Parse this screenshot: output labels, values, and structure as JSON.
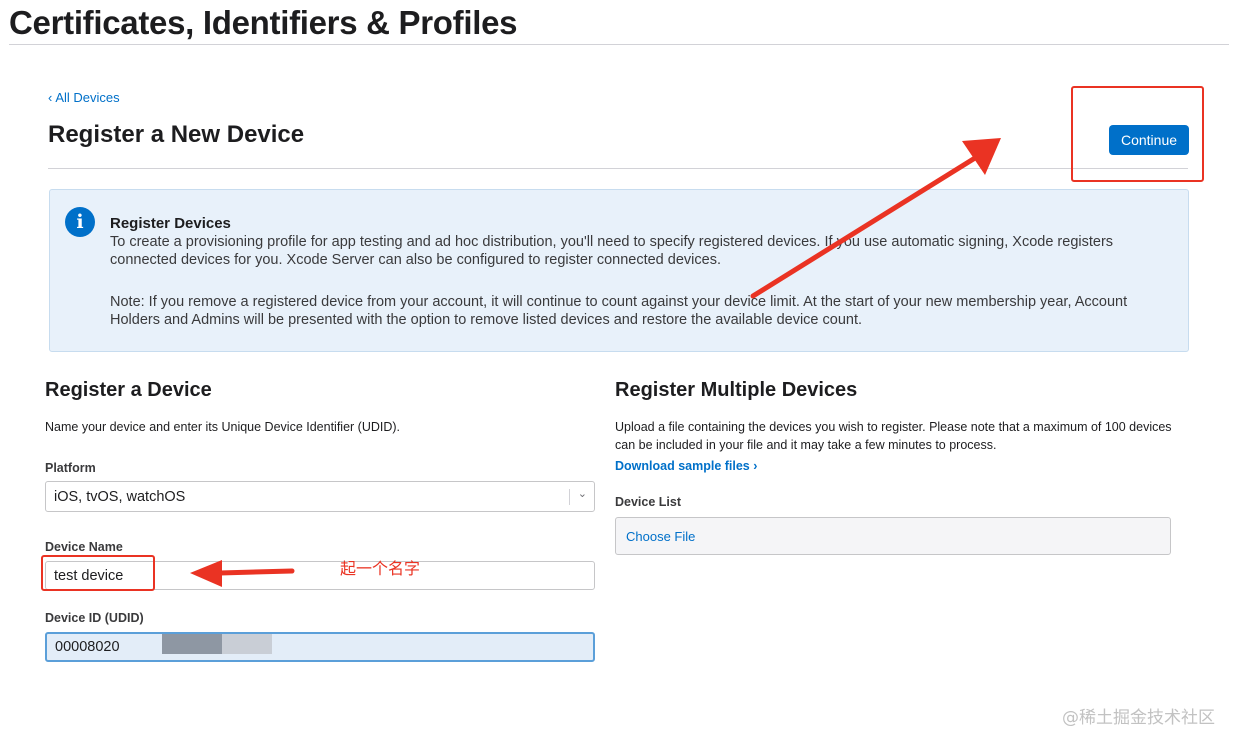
{
  "header": {
    "title": "Certificates, Identifiers & Profiles"
  },
  "nav": {
    "back_label": "All Devices",
    "back_chevron": "‹"
  },
  "page": {
    "title": "Register a New Device",
    "continue_label": "Continue"
  },
  "info": {
    "icon": "info-icon",
    "heading": "Register Devices",
    "paragraph1": "To create a provisioning profile for app testing and ad hoc distribution, you'll need to specify registered devices. If you use automatic signing, Xcode registers connected devices for you. Xcode Server can also be configured to register connected devices.",
    "paragraph2": "Note: If you remove a registered device from your account, it will continue to count against your device limit. At the start of your new membership year, Account Holders and Admins will be presented with the option to remove listed devices and restore the available device count."
  },
  "single": {
    "title": "Register a Device",
    "description": "Name your device and enter its Unique Device Identifier (UDID).",
    "platform_label": "Platform",
    "platform_value": "iOS, tvOS, watchOS",
    "name_label": "Device Name",
    "name_value": "test device",
    "udid_label": "Device ID (UDID)",
    "udid_value": "00008020"
  },
  "multiple": {
    "title": "Register Multiple Devices",
    "description": "Upload a file containing the devices you wish to register. Please note that a maximum of 100 devices can be included in your file and it may take a few minutes to process.",
    "download_label": "Download sample files ›",
    "list_label": "Device List",
    "choose_file_label": "Choose File"
  },
  "annotations": {
    "name_hint": "起一个名字",
    "color": "#ea3323"
  },
  "watermark": "@稀土掘金技术社区",
  "colors": {
    "accent": "#0070c9",
    "info_bg": "#e8f1fa"
  }
}
